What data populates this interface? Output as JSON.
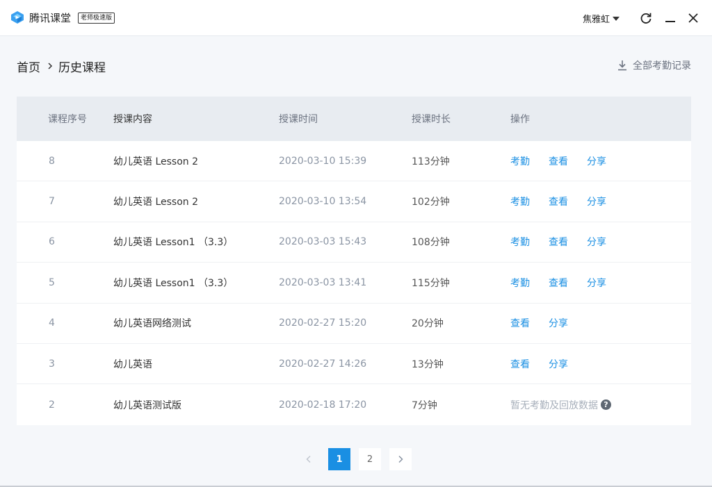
{
  "titlebar": {
    "app_name": "腾讯课堂",
    "edition_badge": "老师极速版",
    "user_name": "焦雅虹"
  },
  "breadcrumb": {
    "home": "首页",
    "current": "历史课程"
  },
  "export_label": "全部考勤记录",
  "table": {
    "headers": {
      "index": "课程序号",
      "content": "授课内容",
      "time": "授课时间",
      "duration": "授课时长",
      "ops": "操作"
    },
    "rows": [
      {
        "index": "8",
        "content": "幼儿英语 Lesson 2",
        "time": "2020-03-10 15:39",
        "duration": "113分钟",
        "ops": [
          "考勤",
          "查看",
          "分享"
        ]
      },
      {
        "index": "7",
        "content": "幼儿英语 Lesson 2",
        "time": "2020-03-10 13:54",
        "duration": "102分钟",
        "ops": [
          "考勤",
          "查看",
          "分享"
        ]
      },
      {
        "index": "6",
        "content": "幼儿英语 Lesson1 （3.3）",
        "time": "2020-03-03 15:43",
        "duration": "108分钟",
        "ops": [
          "考勤",
          "查看",
          "分享"
        ]
      },
      {
        "index": "5",
        "content": "幼儿英语 Lesson1 （3.3）",
        "time": "2020-03-03 13:41",
        "duration": "115分钟",
        "ops": [
          "考勤",
          "查看",
          "分享"
        ]
      },
      {
        "index": "4",
        "content": "幼儿英语网络测试",
        "time": "2020-02-27 15:20",
        "duration": "20分钟",
        "ops": [
          "查看",
          "分享"
        ]
      },
      {
        "index": "3",
        "content": "幼儿英语",
        "time": "2020-02-27 14:26",
        "duration": "13分钟",
        "ops": [
          "查看",
          "分享"
        ]
      },
      {
        "index": "2",
        "content": "幼儿英语测试版",
        "time": "2020-02-18 17:20",
        "duration": "7分钟",
        "ops": [],
        "no_data": "暂无考勤及回放数据"
      }
    ]
  },
  "pagination": {
    "pages": [
      "1",
      "2"
    ],
    "current": "1",
    "help_glyph": "?"
  },
  "colors": {
    "accent": "#1a8fe3",
    "header_bg": "#e8ecf1",
    "page_bg": "#f5f7fa"
  }
}
